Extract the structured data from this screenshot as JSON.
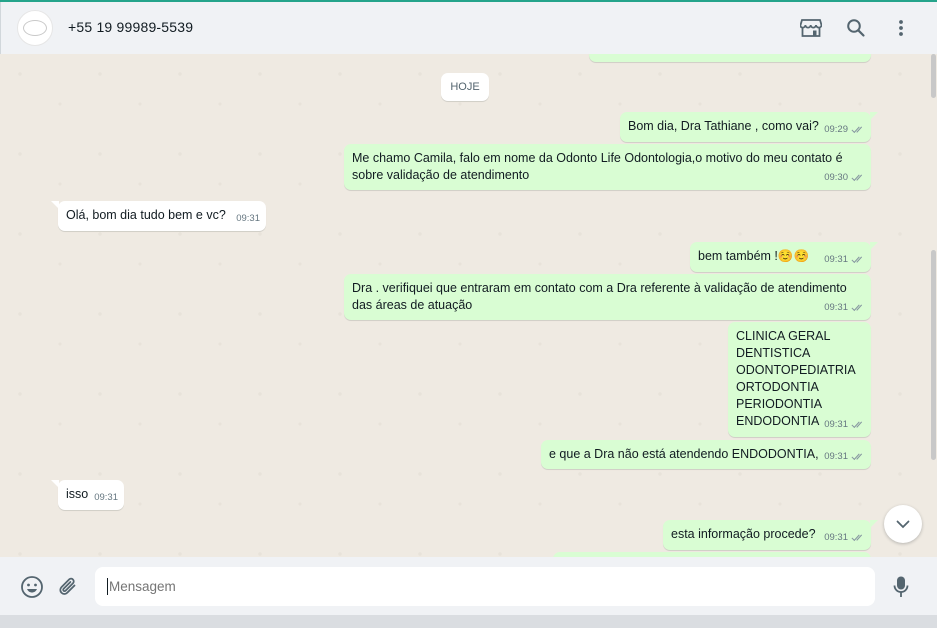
{
  "header": {
    "contact_name": "+55 19 99989-5539",
    "icons": [
      "catalog-icon",
      "search-icon",
      "menu-icon"
    ]
  },
  "chat": {
    "day_badge": "HOJE",
    "messages": [
      {
        "dir": "out",
        "text": "Bom dia, Dra Tathiane , como vai?",
        "time": "09:29"
      },
      {
        "dir": "out",
        "text": "Me chamo Camila, falo em nome da Odonto Life Odontologia,o motivo do meu contato é\nsobre validação de atendimento",
        "time": "09:30"
      },
      {
        "dir": "in",
        "text": "Olá, bom dia tudo bem e vc?",
        "time": "09:31"
      },
      {
        "dir": "out",
        "text": "bem também !☺️☺️",
        "time": "09:31"
      },
      {
        "dir": "out",
        "text": "Dra . verifiquei que entraram em contato com a Dra referente à validação de atendimento\ndas áreas de atuação",
        "time": "09:31"
      },
      {
        "dir": "out",
        "text": "CLINICA GERAL\nDENTISTICA\nODONTOPEDIATRIA\nORTODONTIA\nPERIODONTIA\nENDODONTIA",
        "time": "09:31"
      },
      {
        "dir": "out",
        "text": "e que a Dra não está atendendo ENDODONTIA,",
        "time": "09:31"
      },
      {
        "dir": "in",
        "text": "isso",
        "time": "09:31"
      },
      {
        "dir": "out",
        "text": "esta informação procede?",
        "time": "09:31"
      }
    ]
  },
  "footer": {
    "input_placeholder": "Mensagem",
    "icons": [
      "emoji-icon",
      "attach-icon",
      "microphone-icon"
    ]
  },
  "colors": {
    "outgoing_bubble": "#d9fdd3",
    "incoming_bubble": "#ffffff",
    "chat_background": "#efeae2",
    "header_background": "#f0f2f5",
    "accent": "#25a48b"
  }
}
